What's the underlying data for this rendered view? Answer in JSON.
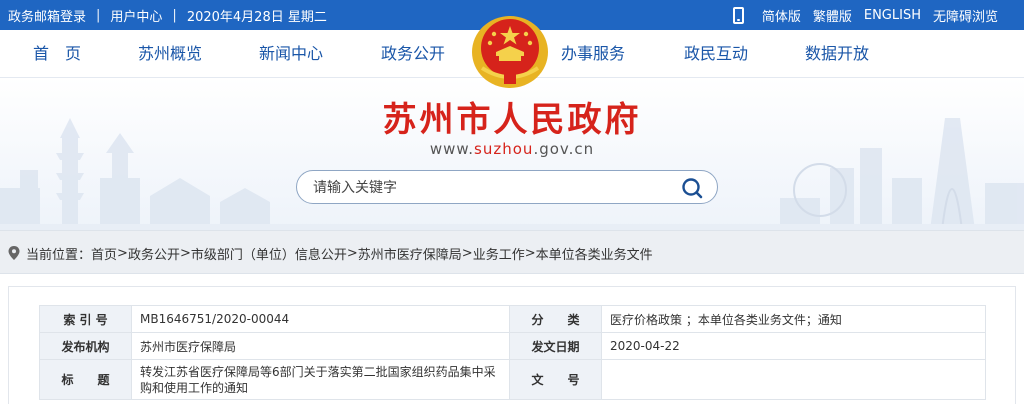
{
  "topbar": {
    "email_login": "政务邮箱登录",
    "user_center": "用户中心",
    "date": "2020年4月28日 星期二",
    "lang_simplified": "简体版",
    "lang_traditional": "繁體版",
    "lang_english": "ENGLISH",
    "accessible": "无障碍浏览",
    "separator": "|"
  },
  "nav": {
    "items": [
      "首　页",
      "苏州概览",
      "新闻中心",
      "政务公开",
      "办事服务",
      "政民互动",
      "数据开放"
    ]
  },
  "site": {
    "title": "苏州市人民政府",
    "url_prefix": "www.",
    "url_domain": "suzhou",
    "url_suffix": ".gov.cn"
  },
  "search": {
    "placeholder": "请输入关键字"
  },
  "breadcrumb": {
    "label": "当前位置：",
    "items": [
      "首页",
      "政务公开",
      "市级部门（单位）信息公开",
      "苏州市医疗保障局",
      "业务工作",
      "本单位各类业务文件"
    ],
    "separator": ">"
  },
  "meta_table": {
    "index_label": "索 引 号",
    "index_value": "MB1646751/2020-00044",
    "category_label": "分　　类",
    "category_value": "医疗价格政策 ；本单位各类业务文件；通知",
    "publisher_label": "发布机构",
    "publisher_value": "苏州市医疗保障局",
    "date_label": "发文日期",
    "date_value": "2020-04-22",
    "title_label": "标　　题",
    "title_value": "转发江苏省医疗保障局等6部门关于落实第二批国家组织药品集中采购和使用工作的通知",
    "docno_label": "文　　号",
    "docno_value": ""
  },
  "colors": {
    "topbar_bg": "#1f66c2",
    "nav_text": "#1a56a8",
    "title_red": "#d6231b",
    "label_bg": "#eef2f7"
  },
  "icons": {
    "phone": "phone-icon",
    "emblem": "national-emblem",
    "search": "search-icon",
    "location": "location-pin-icon"
  }
}
